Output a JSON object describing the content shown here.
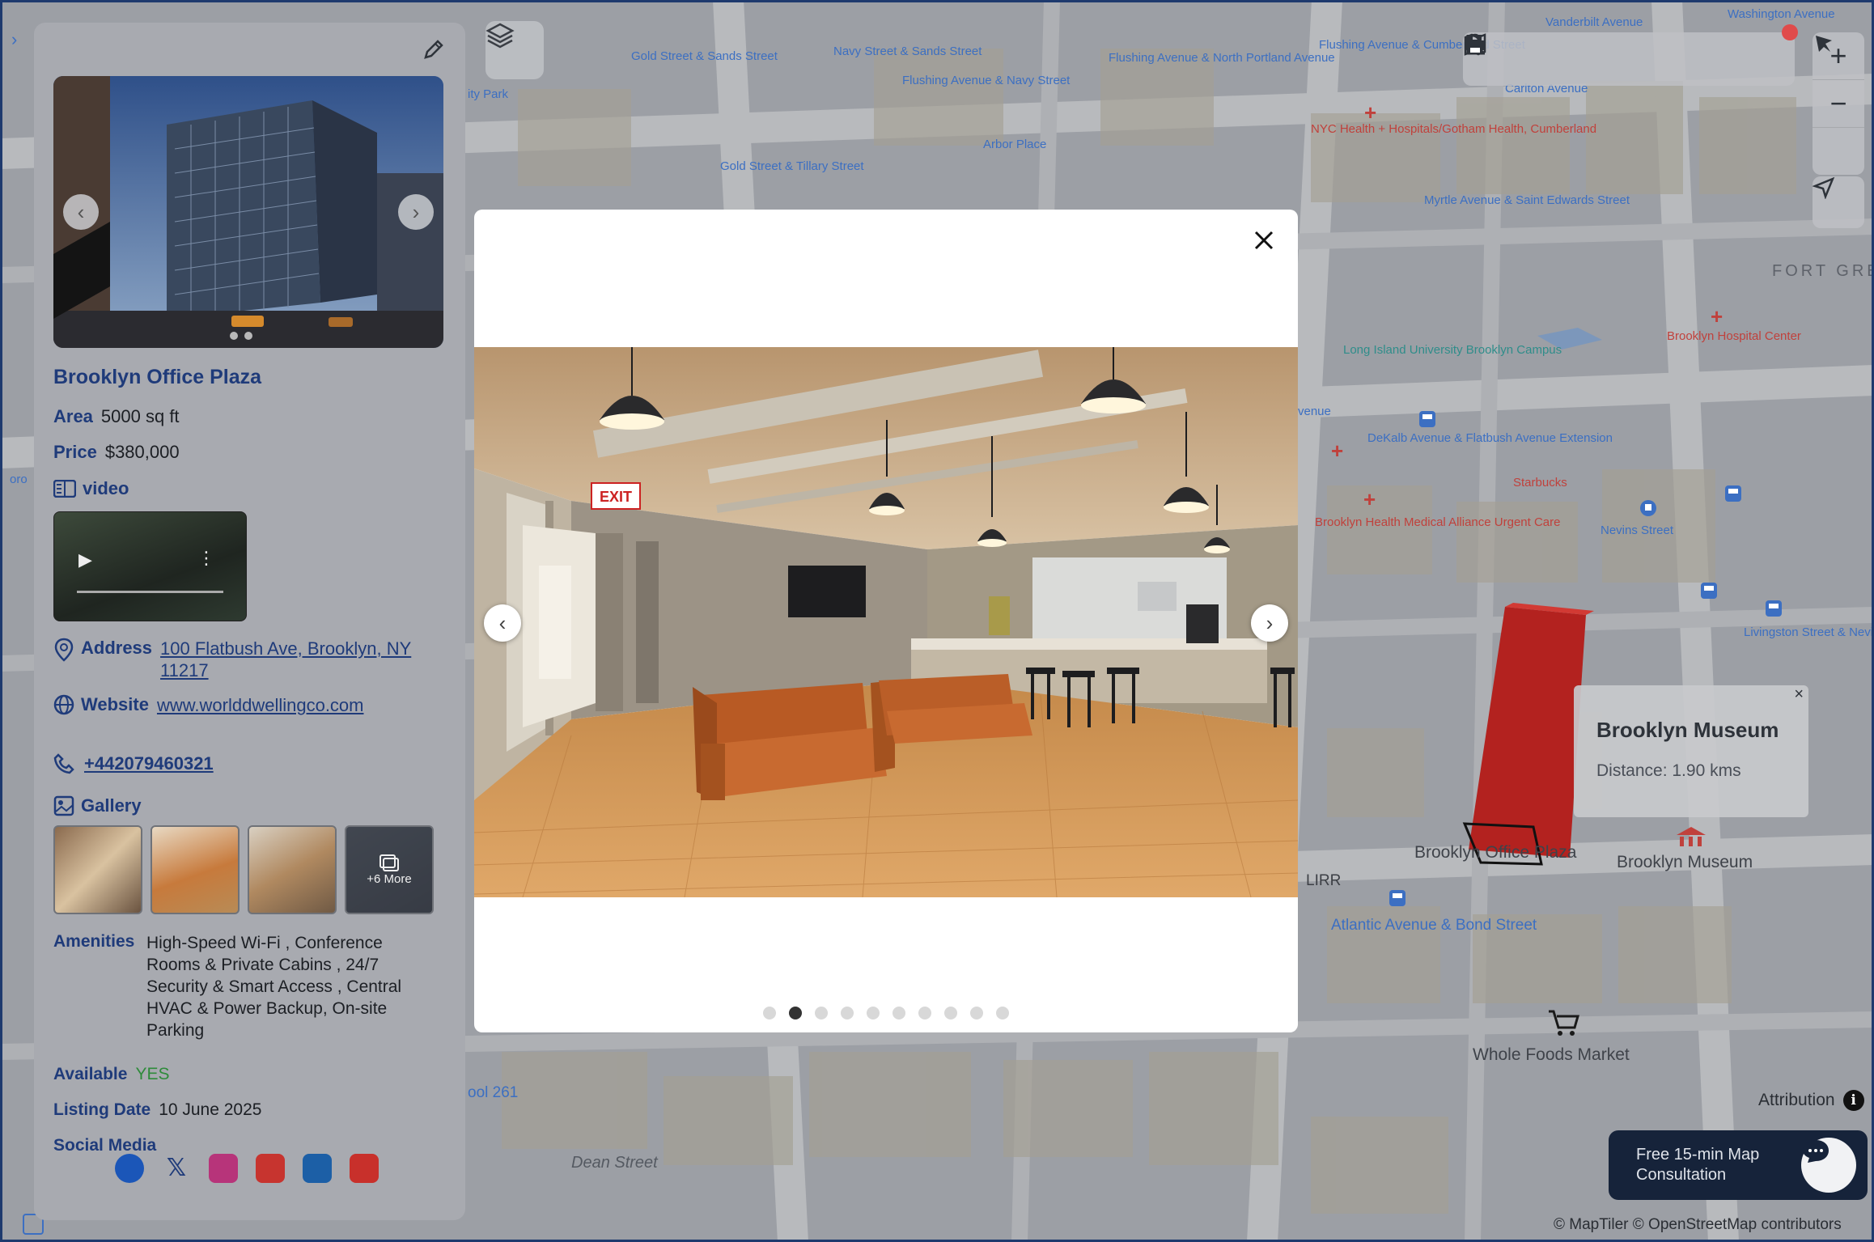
{
  "map": {
    "labels": {
      "gold_sands": "Gold Street & Sands Street",
      "navy_sands": "Navy Street & Sands Street",
      "flushing_navy": "Flushing Avenue & Navy Street",
      "flushing_north_portland": "Flushing Avenue & North Portland Avenue",
      "flushing_cumberland": "Flushing Avenue & Cumberland Street",
      "vanderbilt": "Vanderbilt Avenue",
      "washington": "Washington Avenue",
      "carlton": "Carlton Avenue",
      "arbor_place": "Arbor Place",
      "gold_tillary": "Gold Street & Tillary Street",
      "nyc_health": "NYC Health + Hospitals/Gotham Health, Cumberland",
      "myrtle_saint_edwards": "Myrtle Avenue & Saint Edwards Street",
      "fort_greene": "FORT GREENE",
      "liu_campus": "Long Island University Brooklyn Campus",
      "brooklyn_hospital": "Brooklyn Hospital Center",
      "dekalb_flatbush": "DeKalb Avenue & Flatbush Avenue Extension",
      "starbucks": "Starbucks",
      "brooklyn_health": "Brooklyn Health Medical Alliance Urgent Care",
      "nevins": "Nevins Street",
      "livingston_nevins": "Livingston Street & Nevins Street",
      "brooklyn_office_plaza": "Brooklyn Office Plaza",
      "brooklyn_museum": "Brooklyn Museum",
      "lirr": "LIRR",
      "atlantic_bond": "Atlantic Avenue & Bond Street",
      "whole_foods": "Whole Foods Market",
      "dean_street": "Dean Street",
      "pool": "ool 261",
      "park": "ity Park",
      "venue": "venue",
      "oro": "oro"
    },
    "poi_popup": {
      "title": "Brooklyn Museum",
      "distance": "Distance: 1.90 kms",
      "close": "×"
    },
    "attribution": "Attribution",
    "consultation": "Free 15-min Map Consultation",
    "copyright": "© MapTiler © OpenStreetMap contributors"
  },
  "toolbar": {
    "icons": [
      "map-icon",
      "search-icon",
      "person-icon",
      "measure-icon",
      "print-icon"
    ],
    "zoom_in": "+",
    "zoom_out": "−"
  },
  "listing": {
    "title": "Brooklyn Office Plaza",
    "area_label": "Area",
    "area_value": "5000 sq ft",
    "price_label": "Price",
    "price_value": "$380,000",
    "video_label": "video",
    "address_label": "Address",
    "address_value": "100 Flatbush Ave, Brooklyn, NY 11217",
    "website_label": "Website",
    "website_value": "www.worlddwellingco.com",
    "phone_value": "+442079460321",
    "gallery_label": "Gallery",
    "gallery_more": "+6 More",
    "amenities_label": "Amenities",
    "amenities_value": "High-Speed Wi-Fi , Conference Rooms & Private Cabins , 24/7 Security & Smart Access , Central HVAC & Power Backup, On-site Parking",
    "available_label": "Available",
    "available_value": "YES",
    "listing_date_label": "Listing Date",
    "listing_date_value": "10 June 2025",
    "social_label": "Social Media",
    "social_icons": [
      "facebook-icon",
      "x-icon",
      "instagram-icon",
      "tiktok-icon",
      "linkedin-icon",
      "youtube-icon"
    ]
  },
  "modal": {
    "slide_count": 10,
    "active_slide": 1,
    "close": "×",
    "exit_sign": "EXIT"
  },
  "colors": {
    "accent": "#1f3b7a",
    "available": "#2e8b3a",
    "building_red": "#b3221f"
  }
}
